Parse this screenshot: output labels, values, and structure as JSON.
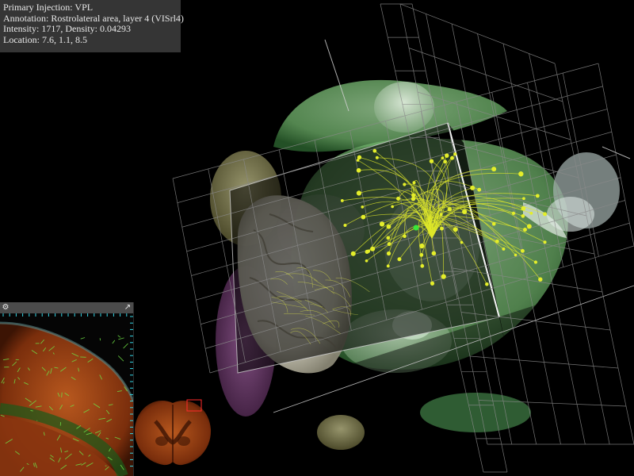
{
  "info": {
    "primary_injection": "Primary Injection: VPL",
    "annotation": "Annotation: Rostrolateral area, layer 4 (VISrl4)",
    "intensity_density": "Intensity: 1717, Density: 0.04293",
    "location": "Location: 7.6, 1.1, 8.5"
  },
  "inset": {
    "settings_icon": "gear-icon",
    "expand_icon": "expand-arrow-icon"
  },
  "colors": {
    "background": "#000000",
    "panel": "#3a3a3a",
    "brain_white": "#d8d6c8",
    "brain_green": "#7fc07a",
    "brain_purple": "#9a4e9a",
    "fibers": "#e4ee2a",
    "section_tissue": "#7a2e0c",
    "axon_green": "#6ee045",
    "tick_cyan": "#35d8e8"
  }
}
